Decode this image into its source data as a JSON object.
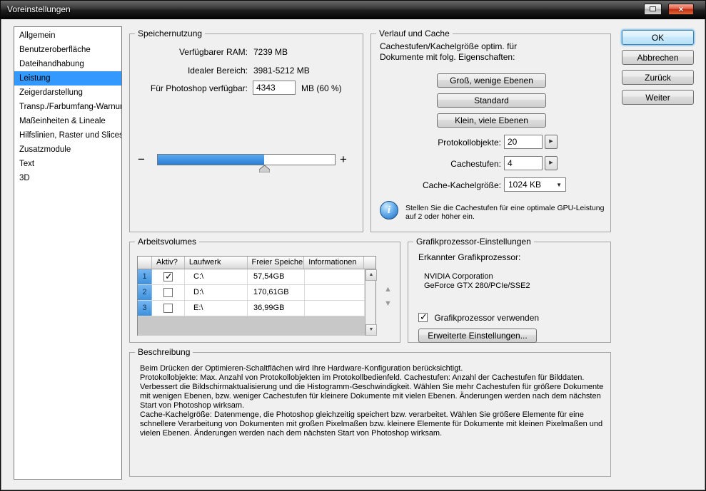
{
  "window": {
    "title": "Voreinstellungen",
    "close_glyph": "×"
  },
  "sidebar": {
    "items": [
      {
        "label": "Allgemein"
      },
      {
        "label": "Benutzeroberfläche"
      },
      {
        "label": "Dateihandhabung"
      },
      {
        "label": "Leistung"
      },
      {
        "label": "Zeigerdarstellung"
      },
      {
        "label": "Transp./Farbumfang-Warnung"
      },
      {
        "label": "Maßeinheiten & Lineale"
      },
      {
        "label": "Hilfslinien, Raster und Slices"
      },
      {
        "label": "Zusatzmodule"
      },
      {
        "label": "Text"
      },
      {
        "label": "3D"
      }
    ],
    "selected": "Leistung"
  },
  "dialog_buttons": {
    "ok": "OK",
    "cancel": "Abbrechen",
    "back": "Zurück",
    "next": "Weiter"
  },
  "memory": {
    "title": "Speichernutzung",
    "available_ram_label": "Verfügbarer RAM:",
    "available_ram_value": "7239 MB",
    "ideal_range_label": "Idealer Bereich:",
    "ideal_range_value": "3981-5212 MB",
    "ps_available_label": "Für Photoshop verfügbar:",
    "ps_available_value": "4343",
    "ps_available_suffix": "MB (60 %)",
    "slider_minus": "−",
    "slider_plus": "+",
    "slider_percent": 60
  },
  "history_cache": {
    "title": "Verlauf und Cache",
    "intro": "Cachestufen/Kachelgröße optim. für\nDokumente mit folg. Eigenschaften:",
    "preset_buttons": [
      "Groß, wenige Ebenen",
      "Standard",
      "Klein, viele Ebenen"
    ],
    "history_label": "Protokollobjekte:",
    "history_value": "20",
    "cache_levels_label": "Cachestufen:",
    "cache_levels_value": "4",
    "tile_size_label": "Cache-Kachelgröße:",
    "tile_size_value": "1024 KB",
    "info_glyph": "i",
    "info_text": "Stellen Sie die Cachestufen für eine optimale GPU-Leistung\nauf 2 oder höher ein."
  },
  "scratch": {
    "title": "Arbeitsvolumes",
    "columns": [
      "Aktiv?",
      "Laufwerk",
      "Freier Speicher",
      "Informationen"
    ],
    "rows": [
      {
        "num": "1",
        "check": "✓",
        "drive": "C:\\",
        "free": "57,54GB",
        "info": ""
      },
      {
        "num": "2",
        "check": "",
        "drive": "D:\\",
        "free": "170,61GB",
        "info": ""
      },
      {
        "num": "3",
        "check": "",
        "drive": "E:\\",
        "free": "36,99GB",
        "info": ""
      }
    ]
  },
  "gpu": {
    "title": "Grafikprozessor-Einstellungen",
    "detected_label": "Erkannter Grafikprozessor:",
    "vendor": "NVIDIA Corporation",
    "model": "GeForce GTX 280/PCIe/SSE2",
    "use_gpu_check": "✓",
    "use_gpu_label": "Grafikprozessor verwenden",
    "advanced_button": "Erweiterte Einstellungen..."
  },
  "description": {
    "title": "Beschreibung",
    "text": "Beim Drücken der Optimieren-Schaltflächen wird Ihre Hardware-Konfiguration berücksichtigt.\nProtokollobjekte: Max. Anzahl von Protokollobjekten im Protokollbedienfeld. Cachestufen: Anzahl der Cachestufen für Bilddaten. Verbessert die Bildschirmaktualisierung und die Histogramm-Geschwindigkeit. Wählen Sie mehr Cachestufen für größere Dokumente mit wenigen Ebenen, bzw. weniger Cachestufen für kleinere Dokumente mit vielen Ebenen. Änderungen werden nach dem nächsten Start von Photoshop wirksam.\nCache-Kachelgröße: Datenmenge, die Photoshop gleichzeitig speichert bzw. verarbeitet. Wählen Sie größere Elemente für eine schnellere Verarbeitung von Dokumenten mit großen Pixelmaßen bzw. kleinere Elemente für Dokumente mit kleinen Pixelmaßen und vielen Ebenen. Änderungen werden nach dem nächsten Start von Photoshop wirksam."
  },
  "icons": {
    "spinner_arrow": "▶",
    "dropdown_arrow": "▼",
    "scroll_up": "▲",
    "scroll_down": "▼",
    "move_up": "▲",
    "move_down": "▼"
  },
  "colors": {
    "selection_blue": "#3399ff",
    "slider_fill": "#2e8ae0",
    "row_number_blue": "#4a9ae2"
  }
}
